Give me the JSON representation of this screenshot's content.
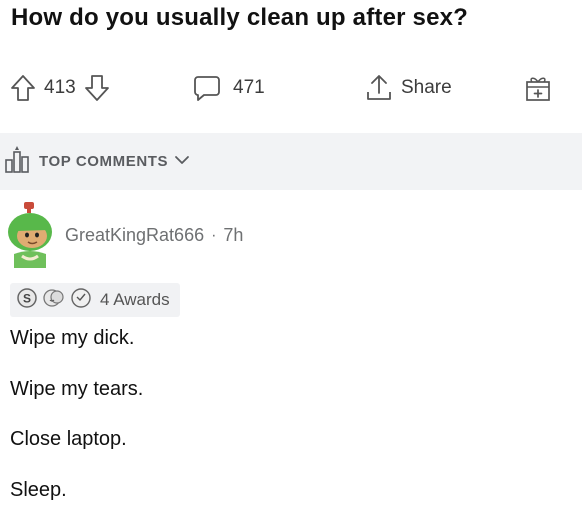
{
  "post": {
    "title": "How do you usually clean up after sex?"
  },
  "actions": {
    "upvote_icon": "upvote-arrow-icon",
    "score": "413",
    "downvote_icon": "downvote-arrow-icon",
    "comments_icon": "comment-bubble-icon",
    "comment_count": "471",
    "share_icon": "share-icon",
    "share_label": "Share",
    "gift_icon": "gift-award-icon"
  },
  "comments_header": {
    "sort_icon": "trophy-sort-icon",
    "sort_label": "TOP COMMENTS",
    "chevron_icon": "chevron-down-icon"
  },
  "comment": {
    "author": "GreatKingRat666",
    "separator": "·",
    "age": "7h",
    "awards_label": "4 Awards",
    "lines": [
      "Wipe my dick.",
      "Wipe my tears.",
      "Close laptop.",
      "Sleep."
    ]
  },
  "colors": {
    "text": "#1a1a1b",
    "muted": "#6e7072",
    "bar_bg": "#f2f3f5",
    "avatar_green": "#58b84a"
  }
}
